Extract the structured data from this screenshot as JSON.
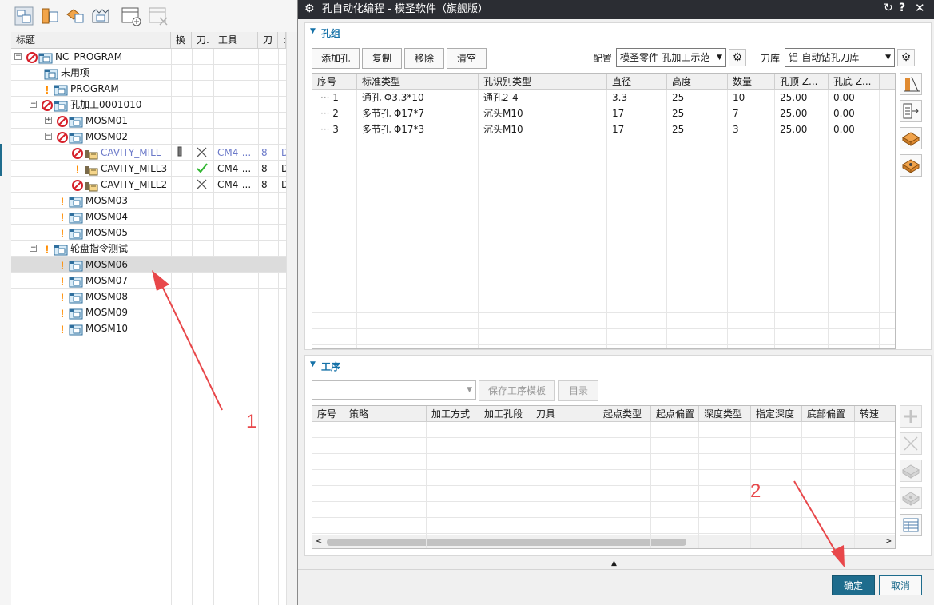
{
  "navigator": {
    "columns": [
      "标题",
      "换",
      "刀.",
      "工具",
      "刀",
      ":"
    ],
    "rows": [
      {
        "name": "NC_PROGRAM",
        "status": "forbid",
        "icon": "program-group-icon",
        "expander": "-",
        "indent": 0,
        "tool": "",
        "num": "",
        "d": ""
      },
      {
        "name": "未用项",
        "status": "",
        "icon": "program-group-icon",
        "expander": "",
        "indent": 1,
        "tool": "",
        "num": "",
        "d": ""
      },
      {
        "name": "PROGRAM",
        "status": "warn",
        "icon": "program-group-icon",
        "expander": "",
        "indent": 1,
        "tool": "",
        "num": "",
        "d": ""
      },
      {
        "name": "孔加工0001010",
        "status": "forbid",
        "icon": "program-group-icon",
        "expander": "-",
        "indent": 1,
        "tool": "",
        "num": "",
        "d": ""
      },
      {
        "name": "MOSM01",
        "status": "forbid",
        "icon": "program-group-icon",
        "expander": "+",
        "indent": 2,
        "tool": "",
        "num": "",
        "d": ""
      },
      {
        "name": "MOSM02",
        "status": "forbid",
        "icon": "program-group-icon",
        "expander": "-",
        "indent": 2,
        "tool": "",
        "num": "",
        "d": ""
      },
      {
        "name": "CAVITY_MILL",
        "status": "forbid",
        "icon": "operation-icon",
        "expander": "",
        "indent": 3,
        "tool": "CM4-...",
        "num": "8",
        "d": "D",
        "dim": true,
        "check": "cross",
        "pencil": true
      },
      {
        "name": "CAVITY_MILL3",
        "status": "warn",
        "icon": "operation-icon",
        "expander": "",
        "indent": 3,
        "tool": "CM4-...",
        "num": "8",
        "d": "D",
        "check": "tick"
      },
      {
        "name": "CAVITY_MILL2",
        "status": "forbid",
        "icon": "operation-icon",
        "expander": "",
        "indent": 3,
        "tool": "CM4-...",
        "num": "8",
        "d": "D",
        "check": "cross"
      },
      {
        "name": "MOSM03",
        "status": "warn",
        "icon": "program-group-icon",
        "expander": "",
        "indent": 2,
        "tool": "",
        "num": "",
        "d": ""
      },
      {
        "name": "MOSM04",
        "status": "warn",
        "icon": "program-group-icon",
        "expander": "",
        "indent": 2,
        "tool": "",
        "num": "",
        "d": ""
      },
      {
        "name": "MOSM05",
        "status": "warn",
        "icon": "program-group-icon",
        "expander": "",
        "indent": 2,
        "tool": "",
        "num": "",
        "d": ""
      },
      {
        "name": "轮盘指令测试",
        "status": "warn",
        "icon": "program-group-icon",
        "expander": "-",
        "indent": 1,
        "tool": "",
        "num": "",
        "d": ""
      },
      {
        "name": "MOSM06",
        "status": "warn",
        "icon": "program-group-icon",
        "expander": "",
        "indent": 2,
        "tool": "",
        "num": "",
        "d": "",
        "selected": true
      },
      {
        "name": "MOSM07",
        "status": "warn",
        "icon": "program-group-icon",
        "expander": "",
        "indent": 2,
        "tool": "",
        "num": "",
        "d": ""
      },
      {
        "name": "MOSM08",
        "status": "warn",
        "icon": "program-group-icon",
        "expander": "",
        "indent": 2,
        "tool": "",
        "num": "",
        "d": ""
      },
      {
        "name": "MOSM09",
        "status": "warn",
        "icon": "program-group-icon",
        "expander": "",
        "indent": 2,
        "tool": "",
        "num": "",
        "d": ""
      },
      {
        "name": "MOSM10",
        "status": "warn",
        "icon": "program-group-icon",
        "expander": "",
        "indent": 2,
        "tool": "",
        "num": "",
        "d": ""
      }
    ]
  },
  "dialog": {
    "title": "孔自动化编程 - 模圣软件（旗舰版）",
    "hole_group": {
      "label": "孔组",
      "add_button": "添加孔",
      "copy_button": "复制",
      "remove_button": "移除",
      "clear_button": "清空",
      "config_label": "配置",
      "config_value": "模圣零件-孔加工示范",
      "toollib_label": "刀库",
      "toollib_value": "铝-自动钻孔刀库",
      "columns": [
        "序号",
        "标准类型",
        "孔识别类型",
        "直径",
        "高度",
        "数量",
        "孔顶 Z...",
        "孔底 Z..."
      ],
      "rows": [
        [
          "1",
          "通孔 Φ3.3*10",
          "通孔2-4",
          "3.3",
          "25",
          "10",
          "25.00",
          "0.00"
        ],
        [
          "2",
          "多节孔 Φ17*7",
          "沉头M10",
          "17",
          "25",
          "7",
          "25.00",
          "0.00"
        ],
        [
          "3",
          "多节孔 Φ17*3",
          "沉头M10",
          "17",
          "25",
          "3",
          "25.00",
          "0.00"
        ]
      ]
    },
    "process": {
      "label": "工序",
      "template_select_value": "",
      "save_template_button": "保存工序模板",
      "catalog_button": "目录",
      "columns": [
        "序号",
        "策略",
        "加工方式",
        "加工孔段",
        "刀具",
        "起点类型",
        "起点偏置",
        "深度类型",
        "指定深度",
        "底部偏置",
        "转速"
      ]
    },
    "ok_button": "确定",
    "cancel_button": "取消"
  },
  "annotations": {
    "arrow1_label": "1",
    "arrow2_label": "2"
  },
  "colors": {
    "accent": "#1672a8",
    "forbid": "#d6202a",
    "warn": "#ff8c00",
    "titlebar": "#2b2d33",
    "ok": "#1e6c8d",
    "arrow": "#e8474a"
  }
}
